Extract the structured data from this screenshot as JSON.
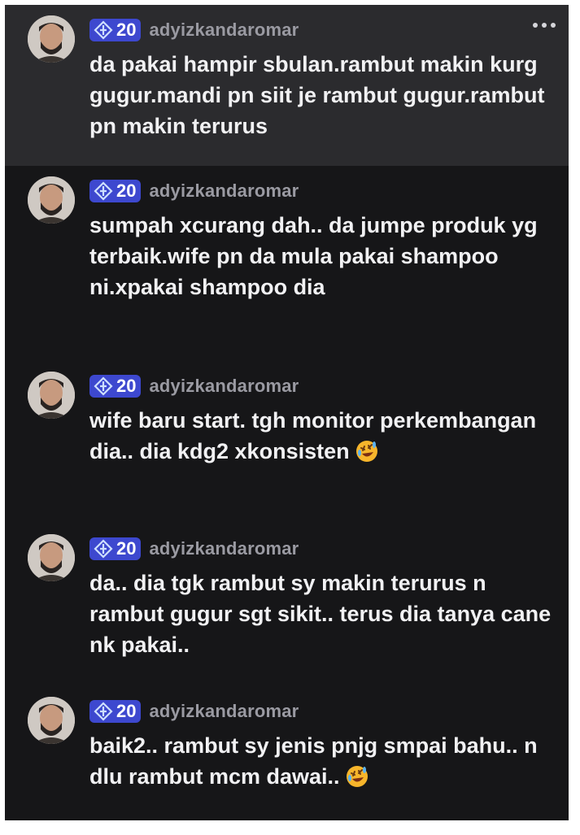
{
  "colors": {
    "background": "#161618",
    "highlight": "#2b2b2e",
    "badge": "#3d48cf",
    "username": "#9a9aa2",
    "text": "#f1f1f3"
  },
  "comments": [
    {
      "badge_level": "20",
      "username": "adyizkandaromar",
      "text": "da pakai hampir sbulan.rambut makin kurg gugur.mandi pn siit je rambut gugur.rambut pn makin terurus",
      "highlighted": true,
      "has_more_menu": true,
      "emoji": ""
    },
    {
      "badge_level": "20",
      "username": "adyizkandaromar",
      "text": "sumpah xcurang dah.. da jumpe produk yg terbaik.wife pn da mula pakai shampoo ni.xpakai shampoo dia",
      "highlighted": false,
      "emoji": ""
    },
    {
      "badge_level": "20",
      "username": "adyizkandaromar",
      "text": "wife baru start. tgh monitor perkembangan dia.. dia kdg2 xkonsisten",
      "highlighted": false,
      "emoji": "rolling-on-floor-laughing-icon"
    },
    {
      "badge_level": "20",
      "username": "adyizkandaromar",
      "text": "da.. dia tgk rambut sy makin terurus n rambut gugur sgt sikit.. terus dia tanya cane nk pakai..",
      "highlighted": false,
      "emoji": ""
    },
    {
      "badge_level": "20",
      "username": "adyizkandaromar",
      "text": "baik2.. rambut sy jenis pnjg smpai bahu.. n dlu rambut mcm dawai..",
      "highlighted": false,
      "emoji": "rolling-on-floor-laughing-icon"
    }
  ]
}
